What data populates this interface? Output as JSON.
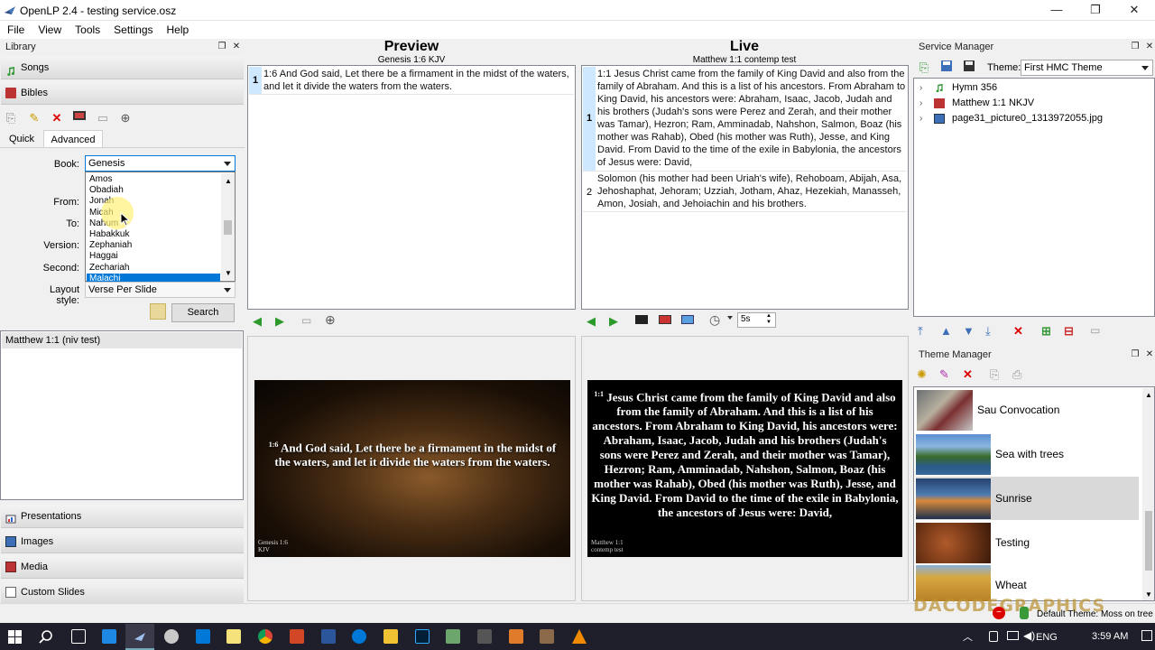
{
  "window": {
    "title": "OpenLP 2.4 - testing service.osz",
    "minimize": "—",
    "maximize": "❐",
    "close": "✕"
  },
  "menu": [
    "File",
    "View",
    "Tools",
    "Settings",
    "Help"
  ],
  "library": {
    "title": "Library",
    "sections_top": [
      "Songs",
      "Bibles"
    ],
    "tabs": [
      "Quick",
      "Advanced"
    ],
    "book_label": "Book:",
    "book_value": "Genesis",
    "book_options": [
      "Amos",
      "Obadiah",
      "Jonah",
      "Micah",
      "Nahum",
      "Habakkuk",
      "Zephaniah",
      "Haggai",
      "Zechariah",
      "Malachi"
    ],
    "book_selected": "Malachi",
    "from_label": "From:",
    "to_label": "To:",
    "version_label": "Version:",
    "second_label": "Second:",
    "layout_label": "Layout style:",
    "layout_value": "Verse Per Slide",
    "search_button": "Search",
    "results": [
      "Matthew 1:1 (niv test)"
    ],
    "sections_bottom": [
      "Presentations",
      "Images",
      "Media",
      "Custom Slides"
    ]
  },
  "preview": {
    "title": "Preview",
    "subtitle": "Genesis 1:6 KJV",
    "row_number": "1",
    "row_text": "1:6 And God said, Let there be a firmament in the midst of the waters, and let it divide the waters from the waters.",
    "screen_verse": "1:6",
    "screen_text": "And God said, Let there be a firmament in the midst of the waters, and let it divide the waters from the waters.",
    "screen_footer_1": "Genesis 1:6",
    "screen_footer_2": "KJV"
  },
  "live": {
    "title": "Live",
    "subtitle": "Matthew 1:1 contemp test",
    "rows": [
      {
        "num": "1",
        "text": "1:1 Jesus Christ came from the family of King David and also from the family of Abraham. And this is a list of his ancestors. From Abraham to King David, his ancestors were: Abraham, Isaac, Jacob, Judah and his brothers (Judah's sons were Perez and Zerah, and their mother was Tamar), Hezron; Ram, Amminadab, Nahshon, Salmon, Boaz (his mother was Rahab), Obed (his mother was Ruth), Jesse, and King David. From David to the time of the exile in Babylonia, the ancestors of Jesus were: David,"
      },
      {
        "num": "2",
        "text": "Solomon (his mother had been Uriah's wife), Rehoboam, Abijah, Asa, Jehoshaphat, Jehoram; Uzziah, Jotham, Ahaz, Hezekiah, Manasseh, Amon, Josiah, and Jehoiachin and his brothers."
      }
    ],
    "delay_value": "5s",
    "screen_verse": "1:1",
    "screen_text": "Jesus Christ came from the family of King David and also from the family of Abraham. And this is a list of his ancestors. From Abraham to King David, his ancestors were: Abraham, Isaac, Jacob, Judah and his brothers (Judah's sons were Perez and Zerah, and their mother was Tamar), Hezron; Ram, Amminadab, Nahshon, Salmon, Boaz (his mother was Rahab), Obed (his mother was Ruth), Jesse, and King David. From David to the time of the exile in Babylonia, the ancestors of Jesus were: David,",
    "screen_footer_1": "Matthew 1:1",
    "screen_footer_2": "contemp test"
  },
  "service_manager": {
    "title": "Service Manager",
    "theme_label": "Theme:",
    "theme_value": "First HMC Theme",
    "items": [
      "Hymn 356",
      "Matthew 1:1 NKJV",
      "page31_picture0_1313972055.jpg"
    ]
  },
  "theme_manager": {
    "title": "Theme Manager",
    "themes": [
      "Sau Convocation",
      "Sea with trees",
      "Sunrise",
      "Testing",
      "Wheat"
    ],
    "selected": "Sunrise"
  },
  "status": {
    "default_theme": "Default Theme: Moss on tree"
  },
  "watermark": "DACODEGRAPHICS",
  "taskbar": {
    "language": "ENG",
    "time": "3:59 AM"
  },
  "colors": {
    "selection": "#0078d7",
    "live_row_selected": "#cde8ff",
    "taskbar": "#1f1f2b"
  }
}
